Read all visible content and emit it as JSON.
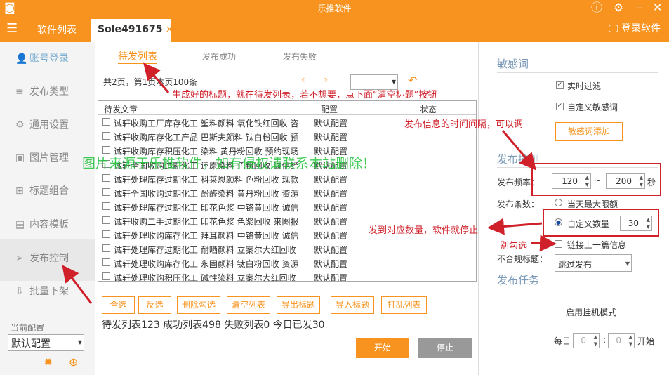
{
  "window": {
    "title": "乐推软件"
  },
  "tabbar": {
    "list_tab": "软件列表",
    "active_tab": "Sole491675",
    "close": "×",
    "login": "登录软件"
  },
  "sidebar": {
    "items": [
      {
        "label": "账号登录",
        "icon": "user-icon"
      },
      {
        "label": "发布类型",
        "icon": "list-icon"
      },
      {
        "label": "通用设置",
        "icon": "gear-icon"
      },
      {
        "label": "图片管理",
        "icon": "image-icon"
      },
      {
        "label": "标题组合",
        "icon": "grid-icon"
      },
      {
        "label": "内容模板",
        "icon": "doc-icon"
      },
      {
        "label": "发布控制",
        "icon": "send-icon"
      },
      {
        "label": "批量下架",
        "icon": "download-icon"
      }
    ],
    "current_config_label": "当前配置",
    "current_config": "默认配置"
  },
  "main": {
    "subtabs": [
      "待发列表",
      "发布成功",
      "发布失败"
    ],
    "page_info": "共2页，第1页本页100条",
    "columns": {
      "article": "待发文章",
      "config": "配置",
      "status": "状态"
    },
    "rows": [
      {
        "title": "诚轩收购工厂库存化工 塑料颜料 氧化铁红回收 咨...",
        "config": "默认配置"
      },
      {
        "title": "诚轩收购库存化工产品 巴斯夫颜料 钛白粉回收 预...",
        "config": "默认配置"
      },
      {
        "title": "诚轩收购库存积压化工 染料 黄丹粉回收 预约现场...",
        "config": "默认配置"
      },
      {
        "title": "诚轩全国收购过期化工 还原染料 色粉回收 诚信经营",
        "config": "默认配置"
      },
      {
        "title": "诚轩处理库存过期化工 科莱恩颜料 色粉回收 现款...",
        "config": "默认配置"
      },
      {
        "title": "诚轩全国收购过期化工 酚醛染料 黄丹粉回收 资源...",
        "config": "默认配置"
      },
      {
        "title": "诚轩处理库存过期化工 印花色浆 中铬黄回收 诚信...",
        "config": "默认配置"
      },
      {
        "title": "诚轩收购二手过期化工 印花色浆 色浆回收 来图报价",
        "config": "默认配置"
      },
      {
        "title": "诚轩处理收购库存化工 拜耳颜料 中铬黄回收 诚信...",
        "config": "默认配置"
      },
      {
        "title": "诚轩处理库存过期化工 耐晒颜料 立案尔大红回收 ...",
        "config": "默认配置"
      },
      {
        "title": "诚轩处理收购库存化工 永固颜料 钛白粉回收 资源...",
        "config": "默认配置"
      },
      {
        "title": "诚轩处理收购积压化工 碱性染料 立案尔大红回收 ...",
        "config": "默认配置"
      }
    ],
    "buttons": [
      "全选",
      "反选",
      "删除勾选",
      "清空列表",
      "导出标题",
      "导入标题",
      "打乱列表"
    ],
    "stats": "待发列表123  成功列表498  失败列表0  今日已发30",
    "start": "开始",
    "stop": "停止"
  },
  "right": {
    "sensitive_title": "敏感词",
    "realtime_filter": "实时过滤",
    "custom_words": "自定义敏感词",
    "add_words": "敏感词添加",
    "publish_control": "发布控制",
    "freq_label": "发布频率：",
    "freq_min": "120",
    "tilde": "~",
    "freq_max": "200",
    "seconds": "秒",
    "count_label": "发布条数：",
    "daily_max": "当天最大限额",
    "custom_count": "自定义数量",
    "count_value": "30",
    "link_prev": "链接上一篇信息",
    "invalid_label": "不合规标题：",
    "invalid_value": "跳过发布",
    "task_title": "发布任务",
    "hang_mode": "启用挂机模式",
    "daily": "每日",
    "h": "0",
    "m": "0",
    "start": "开始"
  },
  "annotations": {
    "a1": "生成好的标题，就在待发列表，若不想要，点下面“清空标题”按钮",
    "a2": "发布信息的时间间隔，可以调",
    "a3": "发到对应数量，软件就停止",
    "a4": "别勾选",
    "watermark": "图片来源于乐推软件，如有侵权请联系本站删除！"
  },
  "colors": {
    "brand": "#f7931e",
    "annotation": "#d0212b",
    "watermark": "#21c23a"
  }
}
